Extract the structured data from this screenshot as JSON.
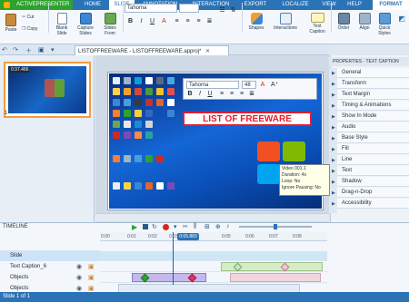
{
  "menubar": {
    "app": "ACTIVEPRESENTER",
    "tabs": [
      "HOME",
      "SLIDE",
      "ANNOTATION",
      "INTERACTION",
      "EXPORT",
      "LOCALIZE",
      "VIEW",
      "HELP",
      "FORMAT"
    ]
  },
  "ribbon": {
    "paste": "Paste",
    "cut": "Cut",
    "copy": "Copy",
    "blank_slide": "Blank Slide",
    "capture_slides": "Capture Slides",
    "slides_from": "Slides From",
    "font": "Tahoma",
    "size": "",
    "shapes": "Shapes",
    "interactions": "Interactions",
    "text_caption": "Text Caption",
    "order": "Order",
    "align": "Align",
    "quick_styles": "Quick Styles"
  },
  "document": {
    "tab_title": "LISTOFFREEWARE - LISTOFFREEWARE.approj*"
  },
  "slides": {
    "thumb_time": "0:37.466",
    "number": "1"
  },
  "canvas": {
    "text_toolbar_font": "Tahoma",
    "text_toolbar_size": "48",
    "callout_text": "LIST OF FREEWARE",
    "tooltip": [
      "Video 001.1",
      "Duration: 4s",
      "Loop: No",
      "Ignore Pausing: No"
    ]
  },
  "properties": {
    "title": "PROPERTIES - TEXT CAPTION",
    "sections": [
      "General",
      "Transform",
      "Text Margin",
      "Timing & Animations",
      "Show In Mode",
      "Audio",
      "Base Style",
      "Fill",
      "Line",
      "Text",
      "Shadow",
      "Drag-n-Drop",
      "Accessibility"
    ]
  },
  "timeline": {
    "label": "TIMELINE",
    "current_time": "0:05.883",
    "ticks": [
      "0:00",
      "0:01",
      "0:02",
      "0:03",
      "0:04",
      "0:05",
      "0:06",
      "0:07",
      "0:08"
    ],
    "rows": [
      "Slide",
      "Text Caption_6",
      "Objects",
      "Objects"
    ]
  },
  "status": {
    "text": "Slide 1 of 1"
  },
  "colors": {
    "menu_blue": "#2b73b7",
    "app_green": "#2ea22e",
    "callout_red": "#e81b2b",
    "thumb_border": "#f39c3b"
  }
}
